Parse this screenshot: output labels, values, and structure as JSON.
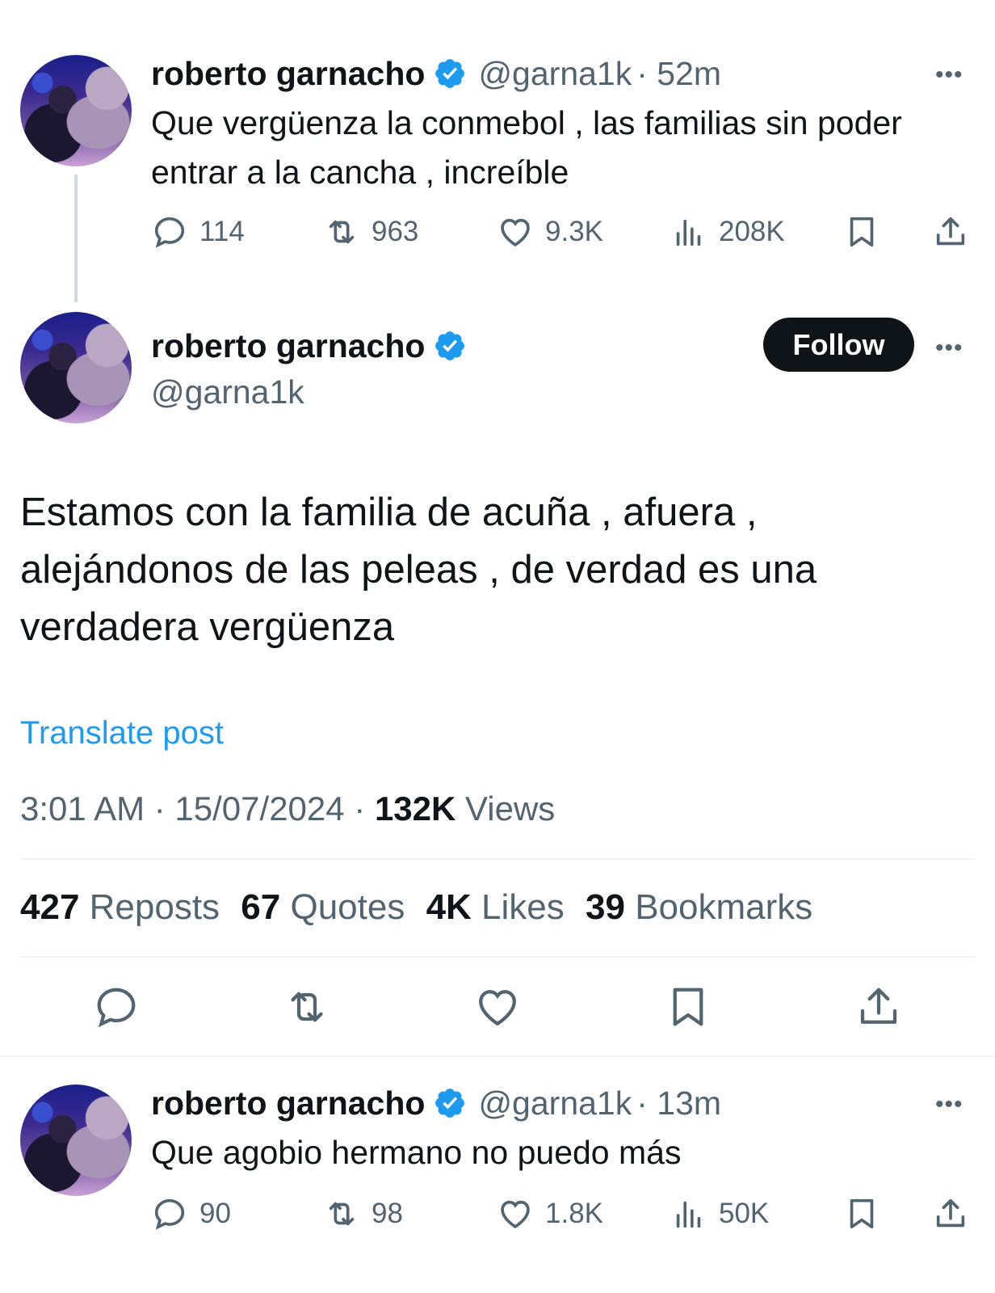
{
  "tweet1": {
    "name": "roberto garnacho",
    "handle": "@garna1k",
    "time": "· 52m",
    "text": "Que vergüenza la conmebol , las familias sin poder entrar a la cancha , increíble",
    "replies": "114",
    "reposts": "963",
    "likes": "9.3K",
    "views": "208K"
  },
  "main": {
    "name": "roberto garnacho",
    "handle": "@garna1k",
    "follow_label": "Follow",
    "text": "Estamos con la familia de acuña , afuera , alejándonos de las peleas , de verdad es una verdadera vergüenza",
    "translate_label": "Translate post",
    "timestamp": "3:01 AM · 15/07/2024 · ",
    "views_count": "132K",
    "views_label": " Views",
    "reposts_count": "427",
    "reposts_label": " Reposts",
    "quotes_count": "67",
    "quotes_label": " Quotes",
    "likes_count": "4K",
    "likes_label": " Likes",
    "bookmarks_count": "39",
    "bookmarks_label": " Bookmarks"
  },
  "tweet3": {
    "name": "roberto garnacho",
    "handle": "@garna1k",
    "time": "· 13m",
    "text": "Que agobio hermano no puedo más",
    "replies": "90",
    "reposts": "98",
    "likes": "1.8K",
    "views": "50K"
  },
  "colors": {
    "accent": "#1d9bf0",
    "text": "#0f1419",
    "secondary": "#536471",
    "verified": "#1d9bf0"
  },
  "icons": [
    "verified-badge-icon",
    "more-icon",
    "reply-icon",
    "repost-icon",
    "like-icon",
    "views-icon",
    "bookmark-icon",
    "share-icon"
  ]
}
